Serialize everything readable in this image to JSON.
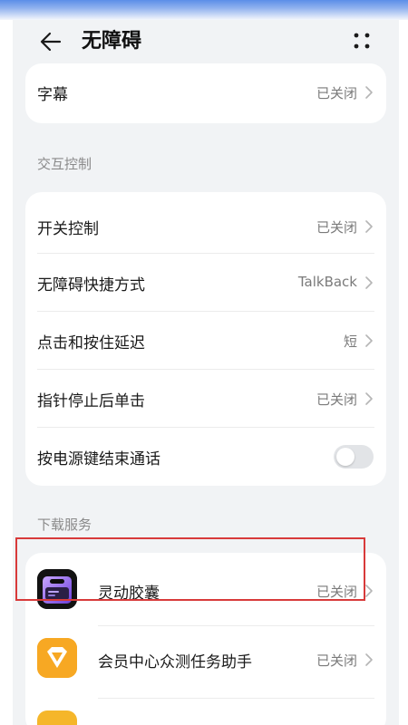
{
  "header": {
    "title": "无障碍",
    "back_icon": "back-arrow-icon",
    "more_icon": "more-dots-icon"
  },
  "top_card": {
    "items": [
      {
        "label": "字幕",
        "value": "已关闭"
      }
    ]
  },
  "interaction": {
    "section_title": "交互控制",
    "items": [
      {
        "label": "开关控制",
        "value": "已关闭"
      },
      {
        "label": "无障碍快捷方式",
        "value": "TalkBack"
      },
      {
        "label": "点击和按住延迟",
        "value": "短"
      },
      {
        "label": "指针停止后单击",
        "value": "已关闭"
      },
      {
        "label": "按电源键结束通话",
        "toggle_on": false
      }
    ]
  },
  "downloads": {
    "section_title": "下载服务",
    "items": [
      {
        "label": "灵动胶囊",
        "value": "已关闭",
        "icon": "dynamic-island-app-icon",
        "highlighted": true
      },
      {
        "label": "会员中心众测任务助手",
        "value": "已关闭",
        "icon": "member-center-app-icon"
      }
    ]
  },
  "colors": {
    "background": "#f1f3f5",
    "card": "#ffffff",
    "highlight": "#d83a3a",
    "member_icon": "#f7a823"
  }
}
